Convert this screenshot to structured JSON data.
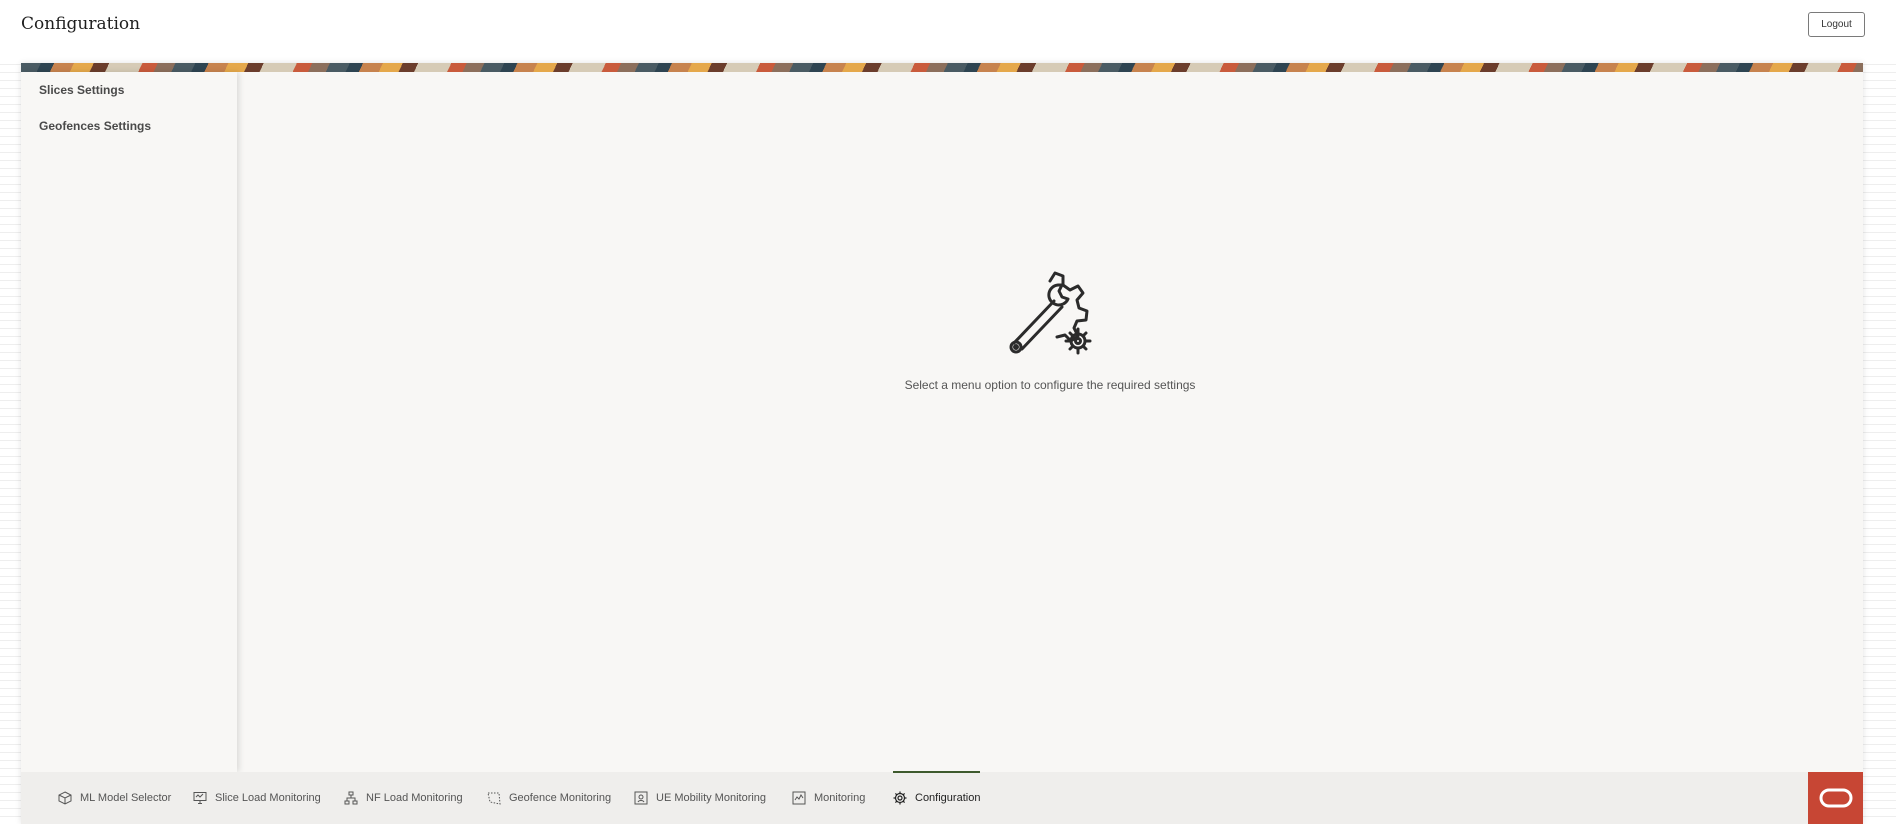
{
  "header": {
    "title": "Configuration",
    "logout_label": "Logout"
  },
  "sidebar": {
    "items": [
      {
        "label": "Slices Settings"
      },
      {
        "label": "Geofences Settings"
      }
    ]
  },
  "main": {
    "empty_state_icon": "wrench-gear-icon",
    "empty_state_text": "Select a menu option to configure the required settings"
  },
  "nav": {
    "items": [
      {
        "label": "ML Model Selector",
        "icon": "cube-icon"
      },
      {
        "label": "Slice Load Monitoring",
        "icon": "monitor-icon"
      },
      {
        "label": "NF Load Monitoring",
        "icon": "network-icon"
      },
      {
        "label": "Geofence Monitoring",
        "icon": "geofence-icon"
      },
      {
        "label": "UE Mobility Monitoring",
        "icon": "mobility-icon"
      },
      {
        "label": "Monitoring",
        "icon": "chart-icon"
      },
      {
        "label": "Configuration",
        "icon": "gear-icon",
        "active": true
      }
    ]
  },
  "colors": {
    "accent": "#3e5a2d",
    "brand": "#c74634"
  }
}
